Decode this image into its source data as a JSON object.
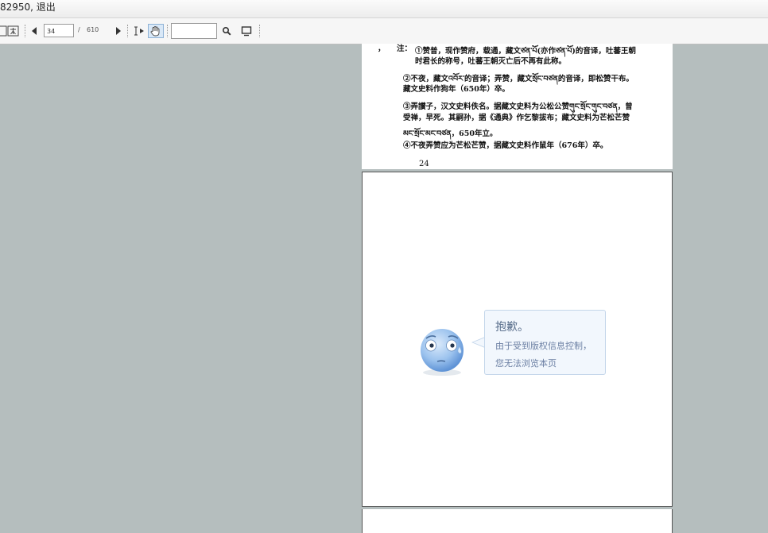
{
  "topbar": {
    "user_text": "82950, 退出"
  },
  "toolbar": {
    "current_page": "34",
    "separator": "/",
    "total_pages": "610",
    "search_value": "",
    "tools": [
      "page-view-icon",
      "zoom-icon",
      "prev-page-icon",
      "next-page-icon",
      "text-select-icon",
      "hand-tool-icon",
      "search-icon",
      "fullscreen-icon"
    ]
  },
  "document": {
    "notes": [
      {
        "prefix": "，",
        "label": "注：",
        "text": "①赞普，现作赞府，载通，藏文ཙན་པོ(亦作ཙན་པོ)的音译，吐蕃王朝"
      },
      {
        "text": "时君长的称号，吐蕃王朝灭亡后不再有此称。"
      },
      {
        "text": "②不夜，藏文འབོར་的音译；弄赞，藏文སྲོང་བཙན的音译，即松赞干布。"
      },
      {
        "text": "藏文史料作狗年（650年）卒。"
      },
      {
        "text": "③弄讃子，汉文史料佚名。据藏文史料为公松公赞གུང་སྲོང་གུང་བཙན，曾"
      },
      {
        "text": "受禅，早死。其嗣孙，据《通典》作乞黎拔布；藏文史料为芒松芒赞"
      },
      {
        "text": "མང་སྲོང་མང་བཙན，650年立。"
      },
      {
        "text": "④不夜弄赞应为芒松芒赞，据藏文史料作鼠年（676年）卒。"
      }
    ],
    "page_number": "24"
  },
  "notice": {
    "title": "抱歉。",
    "line1": "由于受到版权信息控制，",
    "line2": "您无法浏览本页"
  },
  "colors": {
    "viewer_background": "#b5bebe",
    "bubble_border": "#c4d6ea",
    "bubble_fill": "#f2f7fd",
    "face": "#8fb9ea"
  }
}
